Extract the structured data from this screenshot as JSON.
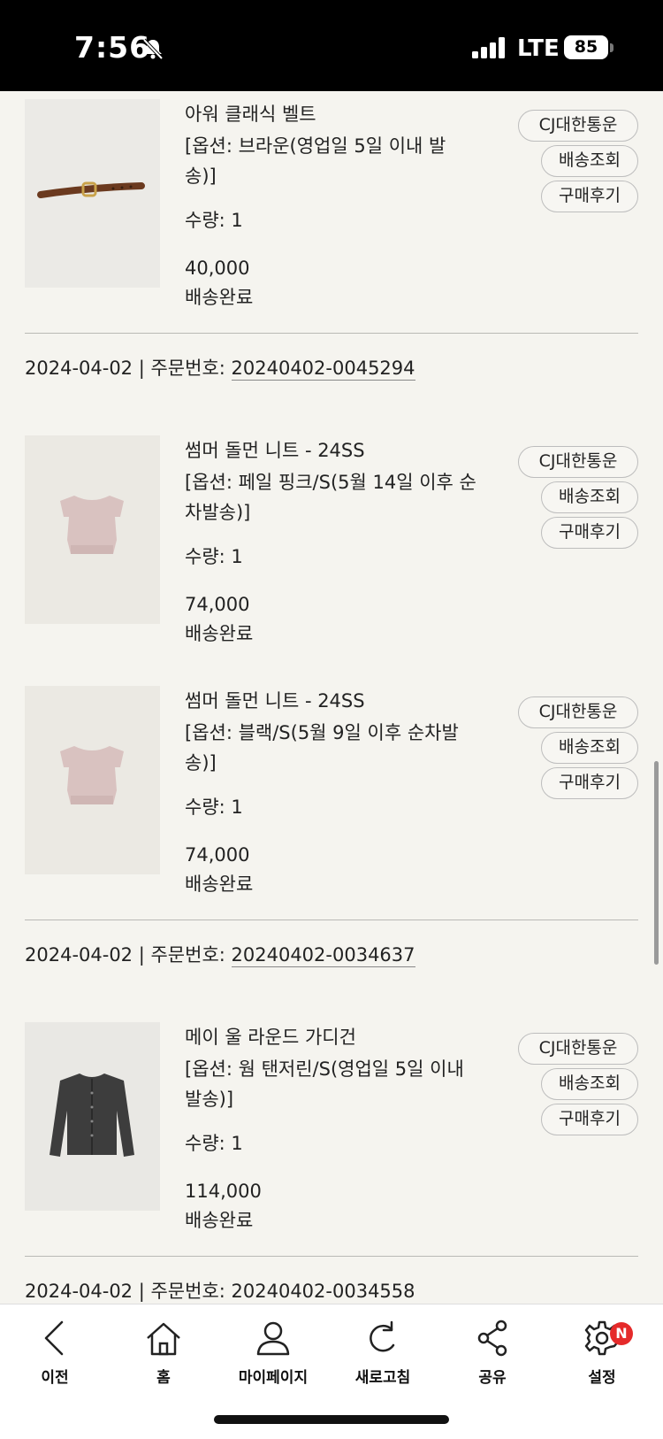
{
  "status_bar": {
    "time": "7:56",
    "network": "LTE",
    "battery": "85"
  },
  "items": [
    {
      "name": "아워 클래식 벨트",
      "option": "[옵션: 브라운(영업일 5일 이내 발송)]",
      "qty": "수량: 1",
      "price": "40,000",
      "status": "배송완료",
      "carrier": "CJ대한통운",
      "track": "배송조회",
      "review": "구매후기",
      "image": "belt"
    },
    {
      "name": "썸머 돌먼 니트 - 24SS",
      "option": "[옵션: 페일 핑크/S(5월 14일 이후 순차발송)]",
      "qty": "수량: 1",
      "price": "74,000",
      "status": "배송완료",
      "carrier": "CJ대한통운",
      "track": "배송조회",
      "review": "구매후기",
      "image": "knit-pink"
    },
    {
      "name": "썸머 돌먼 니트 - 24SS",
      "option": "[옵션: 블랙/S(5월 9일 이후 순차발송)]",
      "qty": "수량: 1",
      "price": "74,000",
      "status": "배송완료",
      "carrier": "CJ대한통운",
      "track": "배송조회",
      "review": "구매후기",
      "image": "knit-pink"
    },
    {
      "name": "메이 울 라운드 가디건",
      "option": "[옵션: 웜 탠저린/S(영업일 5일 이내 발송)]",
      "qty": "수량: 1",
      "price": "114,000",
      "status": "배송완료",
      "carrier": "CJ대한통운",
      "track": "배송조회",
      "review": "구매후기",
      "image": "cardigan"
    }
  ],
  "orders": [
    {
      "date": "2024-04-02",
      "sep": " | ",
      "label": "주문번호: ",
      "number": "20240402-0045294"
    },
    {
      "date": "2024-04-02",
      "sep": " | ",
      "label": "주문번호: ",
      "number": "20240402-0034637"
    },
    {
      "date": "2024-04-02",
      "sep": " | ",
      "label": "주문번호: ",
      "number": "20240402-0034558"
    }
  ],
  "tabbar": {
    "prev": "이전",
    "home": "홈",
    "mypage": "마이페이지",
    "refresh": "새로고침",
    "share": "공유",
    "settings": "설정",
    "settings_badge": "N"
  },
  "colors": {
    "background": "#f5f4ef",
    "badge": "#e52a2a",
    "divider": "#b9b9b5"
  }
}
